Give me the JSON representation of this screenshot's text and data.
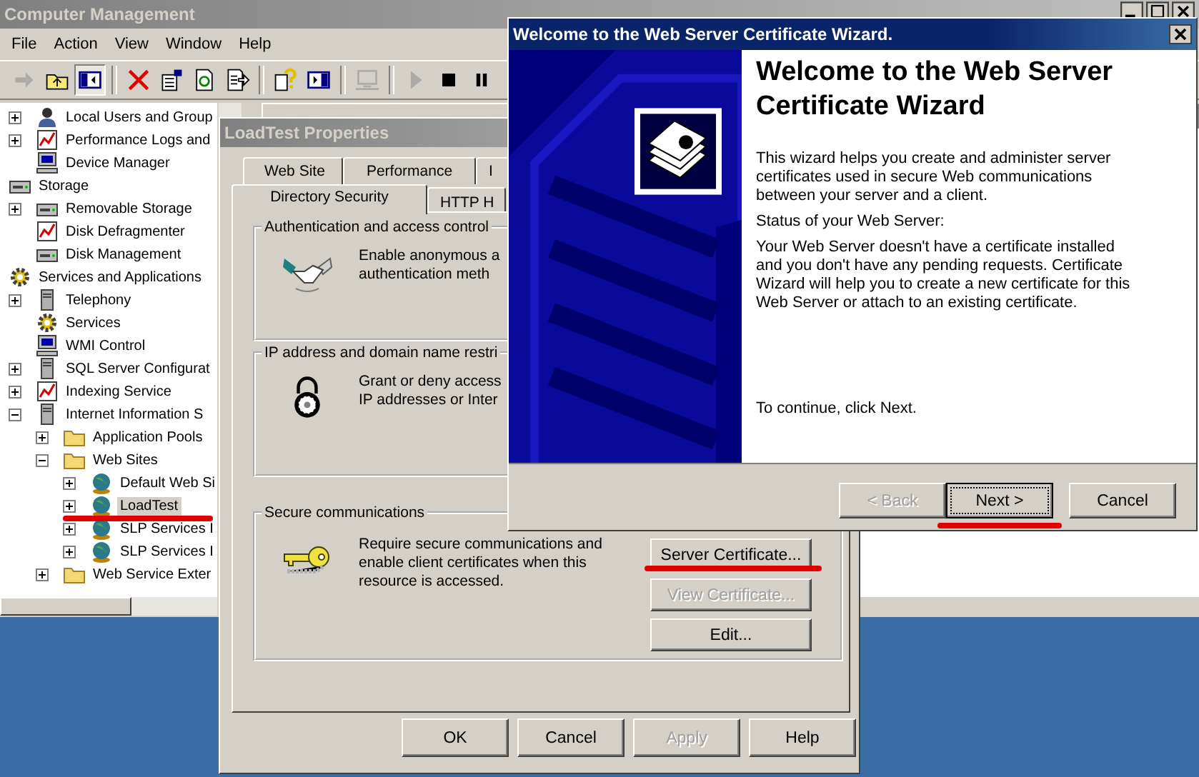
{
  "main_window": {
    "title": "Computer Management",
    "menu": [
      "File",
      "Action",
      "View",
      "Window",
      "Help"
    ],
    "toolbar": [
      {
        "kind": "back",
        "disabled": true,
        "pressed": false
      },
      {
        "kind": "up",
        "disabled": false,
        "pressed": false
      },
      {
        "kind": "tree",
        "disabled": false,
        "pressed": true
      },
      {
        "kind": "sep"
      },
      {
        "kind": "delete",
        "disabled": false,
        "pressed": false
      },
      {
        "kind": "properties",
        "disabled": false,
        "pressed": false
      },
      {
        "kind": "refresh",
        "disabled": false,
        "pressed": false
      },
      {
        "kind": "export",
        "disabled": false,
        "pressed": false
      },
      {
        "kind": "sep"
      },
      {
        "kind": "help",
        "disabled": false,
        "pressed": false
      },
      {
        "kind": "panel",
        "disabled": false,
        "pressed": false
      },
      {
        "kind": "sep"
      },
      {
        "kind": "computer",
        "disabled": true,
        "pressed": false
      },
      {
        "kind": "sep"
      },
      {
        "kind": "play",
        "disabled": true,
        "pressed": false
      },
      {
        "kind": "stop",
        "disabled": false,
        "pressed": false
      },
      {
        "kind": "pause",
        "disabled": false,
        "pressed": false
      }
    ],
    "tree": [
      {
        "children": [
          {
            "label": "Local Users and Group",
            "kind": "users",
            "expanded": false,
            "selected": false
          },
          {
            "label": "Performance Logs and",
            "kind": "chart",
            "expanded": false,
            "selected": false
          },
          {
            "label": "Device Manager",
            "kind": "computer",
            "selected": false
          }
        ]
      },
      {
        "label": "Storage",
        "kind": "drive",
        "selected": false,
        "children": [
          {
            "label": "Removable Storage",
            "kind": "drive",
            "expanded": false,
            "selected": false
          },
          {
            "label": "Disk Defragmenter",
            "kind": "chart",
            "selected": false
          },
          {
            "label": "Disk Management",
            "kind": "drive",
            "selected": false
          }
        ]
      },
      {
        "label": "Services and Applications",
        "kind": "gear",
        "selected": false,
        "children": [
          {
            "label": "Telephony",
            "kind": "server",
            "expanded": false,
            "selected": false
          },
          {
            "label": "Services",
            "kind": "gear",
            "selected": false
          },
          {
            "label": "WMI Control",
            "kind": "computer",
            "selected": false
          },
          {
            "label": "SQL Server Configurat",
            "kind": "server",
            "expanded": false,
            "selected": false
          },
          {
            "label": "Indexing Service",
            "kind": "chart",
            "expanded": false,
            "selected": false
          },
          {
            "label": "Internet Information S",
            "kind": "server",
            "expanded": true,
            "selected": false,
            "children": [
              {
                "label": "Application Pools",
                "kind": "folder",
                "expanded": false,
                "selected": false
              },
              {
                "label": "Web Sites",
                "kind": "folder",
                "expanded": true,
                "selected": false,
                "children": [
                  {
                    "label": "Default Web Si",
                    "kind": "globe",
                    "expanded": false,
                    "selected": false
                  },
                  {
                    "label": "LoadTest",
                    "kind": "globe",
                    "expanded": false,
                    "selected": true
                  },
                  {
                    "label": "SLP Services I",
                    "kind": "globe",
                    "expanded": false,
                    "selected": false
                  },
                  {
                    "label": "SLP Services I",
                    "kind": "globe",
                    "expanded": false,
                    "selected": false
                  }
                ]
              },
              {
                "label": "Web Service Exter",
                "kind": "folder",
                "expanded": false,
                "selected": false
              }
            ]
          }
        ]
      }
    ]
  },
  "properties_dialog": {
    "title": "LoadTest Properties",
    "tab_rows": [
      [
        {
          "label": "Web Site",
          "selected": false
        },
        {
          "label": "Performance",
          "selected": false
        },
        {
          "label": "I",
          "selected": false
        }
      ],
      [
        {
          "label": "Directory Security",
          "selected": true
        },
        {
          "label": "HTTP H",
          "selected": false
        }
      ]
    ],
    "groups": [
      {
        "kind": "auth",
        "title": "Authentication and access control",
        "lines": [
          "Enable anonymous a",
          "authentication meth"
        ]
      },
      {
        "kind": "ip",
        "title": "IP address and domain name restri",
        "lines": [
          "Grant or deny access",
          "IP addresses or Inter"
        ]
      },
      {
        "kind": "secure",
        "title": "Secure communications",
        "lines": [
          "Require secure communications and",
          "enable client certificates when this",
          "resource is accessed."
        ],
        "buttons": [
          {
            "label": "Server Certificate...",
            "disabled": false
          },
          {
            "label": "View Certificate...",
            "disabled": true
          },
          {
            "label": "Edit...",
            "disabled": false
          }
        ]
      }
    ],
    "buttons": [
      {
        "label": "OK",
        "disabled": false
      },
      {
        "label": "Cancel",
        "disabled": false
      },
      {
        "label": "Apply",
        "disabled": true
      },
      {
        "label": "Help",
        "disabled": false
      }
    ]
  },
  "wizard": {
    "title": "Welcome to the Web Server Certificate Wizard.",
    "heading": "Welcome to the Web Server Certificate Wizard",
    "paragraphs": [
      "This wizard helps you create and administer server certificates used in secure Web communications between your server and a client.",
      "Status of your Web Server:",
      "Your Web Server doesn't have a certificate installed and you don't have any pending requests. Certificate Wizard will help you to create a new certificate for this Web Server or attach to an existing certificate."
    ],
    "footer_text": "To continue, click Next.",
    "buttons": [
      {
        "label": "< Back",
        "disabled": true,
        "focused": false
      },
      {
        "label": "Next >",
        "disabled": false,
        "focused": true
      },
      {
        "label": "Cancel",
        "disabled": false,
        "focused": false
      }
    ]
  }
}
